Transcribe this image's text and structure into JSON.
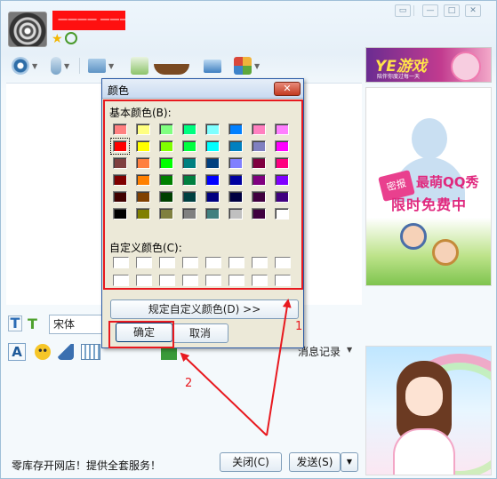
{
  "contact": {
    "name": "一一一一 一一一"
  },
  "dialog": {
    "title": "颜色",
    "close_glyph": "✕",
    "basic_colors_label": "基本颜色(B):",
    "custom_colors_label": "自定义颜色(C):",
    "define_custom_button": "规定自定义颜色(D) >>",
    "ok_button": "确定",
    "cancel_button": "取消",
    "basic_colors": [
      [
        "#ff8080",
        "#ffff80",
        "#80ff80",
        "#00ff80",
        "#80ffff",
        "#0080ff",
        "#ff80c0",
        "#ff80ff"
      ],
      [
        "#ff0000",
        "#ffff00",
        "#80ff00",
        "#00ff40",
        "#00ffff",
        "#0080c0",
        "#8080c0",
        "#ff00ff"
      ],
      [
        "#804040",
        "#ff8040",
        "#00ff00",
        "#008080",
        "#004080",
        "#8080ff",
        "#800040",
        "#ff0080"
      ],
      [
        "#800000",
        "#ff8000",
        "#008000",
        "#008040",
        "#0000ff",
        "#0000a0",
        "#800080",
        "#8000ff"
      ],
      [
        "#400000",
        "#804000",
        "#004000",
        "#004040",
        "#000080",
        "#000040",
        "#400040",
        "#400080"
      ],
      [
        "#000000",
        "#808000",
        "#808040",
        "#808080",
        "#408080",
        "#c0c0c0",
        "#400040",
        "#ffffff"
      ]
    ],
    "selected_color": "#ff0000"
  },
  "input": {
    "font_name": "宋体",
    "history_label": "消息记录"
  },
  "ads": {
    "top_logo": "YE游戏",
    "top_logo_sub": "陪伴你度过每一天",
    "mid_tag": "密报",
    "mid_line1": "最萌QQ秀",
    "mid_line2": "限时免费中"
  },
  "status": {
    "ad_text": "零库存开网店！提供全套服务！",
    "close_button": "关闭(C)",
    "send_button": "发送(S)"
  },
  "annotations": {
    "label1": "1",
    "label2": "2"
  },
  "colors": {
    "annotation_red": "#e8191f",
    "accent_blue": "#2a5aa5"
  },
  "icons": [
    "camera-icon",
    "microphone-icon",
    "folder-icon",
    "add-contact-icon",
    "boat-icon",
    "monitor-icon",
    "app-icon",
    "font-icon",
    "smiley-icon",
    "ink-icon",
    "screenshot-icon",
    "gift-icon"
  ]
}
